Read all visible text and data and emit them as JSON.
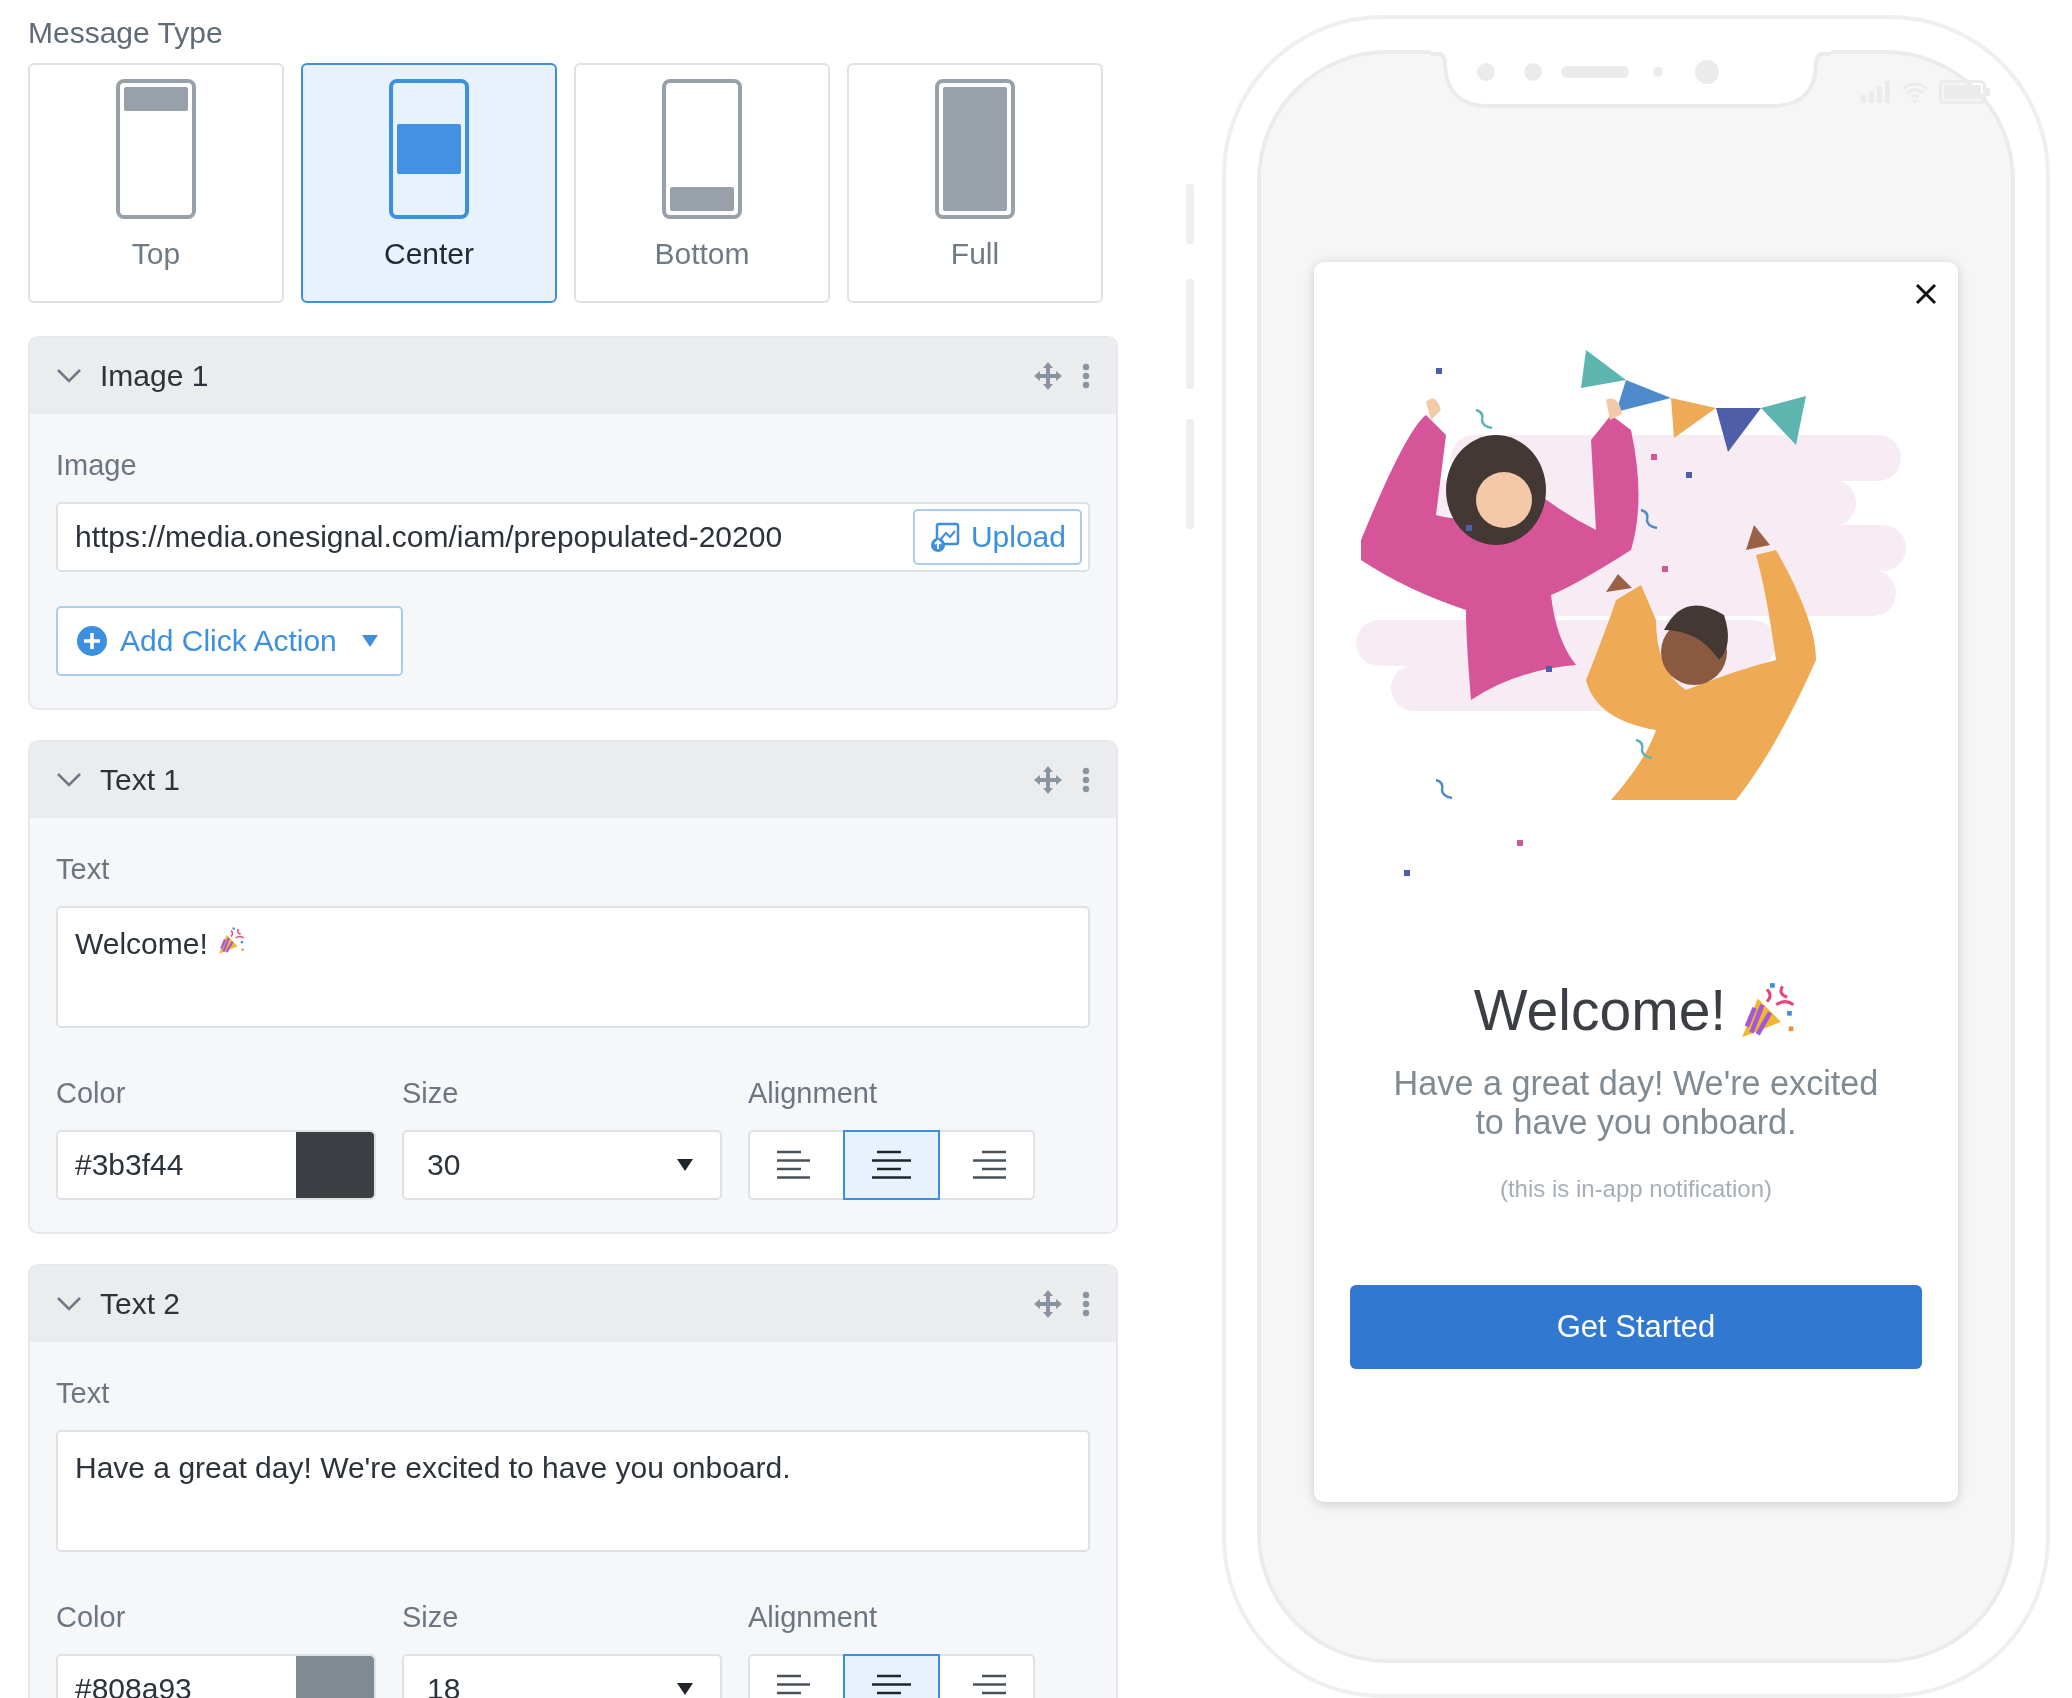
{
  "message_type": {
    "label": "Message Type",
    "options": [
      {
        "label": "Top",
        "kind": "top",
        "selected": false
      },
      {
        "label": "Center",
        "kind": "center",
        "selected": true
      },
      {
        "label": "Bottom",
        "kind": "bottom",
        "selected": false
      },
      {
        "label": "Full",
        "kind": "full",
        "selected": false
      }
    ]
  },
  "blocks": [
    {
      "kind": "image",
      "title": "Image 1",
      "expanded": true,
      "field_label": "Image",
      "url": "https://media.onesignal.com/iam/prepopulated-20200",
      "upload": "Upload",
      "action": "Add Click Action"
    },
    {
      "kind": "text",
      "title": "Text 1",
      "expanded": true,
      "text_label": "Text",
      "text": "Welcome!",
      "color_label": "Color",
      "color": "#3b3f44",
      "size_label": "Size",
      "size": "30",
      "alignment_label": "Alignment",
      "alignment": [
        {
          "kind": "left",
          "selected": false
        },
        {
          "kind": "center",
          "selected": true
        },
        {
          "kind": "right",
          "selected": false
        }
      ]
    },
    {
      "kind": "text",
      "title": "Text 2",
      "expanded": true,
      "text_label": "Text",
      "text": "Have a great day! We're excited to have you onboard.",
      "color_label": "Color",
      "color": "#808a93",
      "size_label": "Size",
      "size": "18",
      "alignment_label": "Alignment",
      "alignment": [
        {
          "kind": "left",
          "selected": false
        },
        {
          "kind": "center",
          "selected": true
        },
        {
          "kind": "right",
          "selected": false
        }
      ]
    }
  ],
  "preview": {
    "title": "Welcome!",
    "body": "Have a great day! We're excited to have you onboard.",
    "note": "(this is in-app notification)",
    "button": "Get Started"
  }
}
